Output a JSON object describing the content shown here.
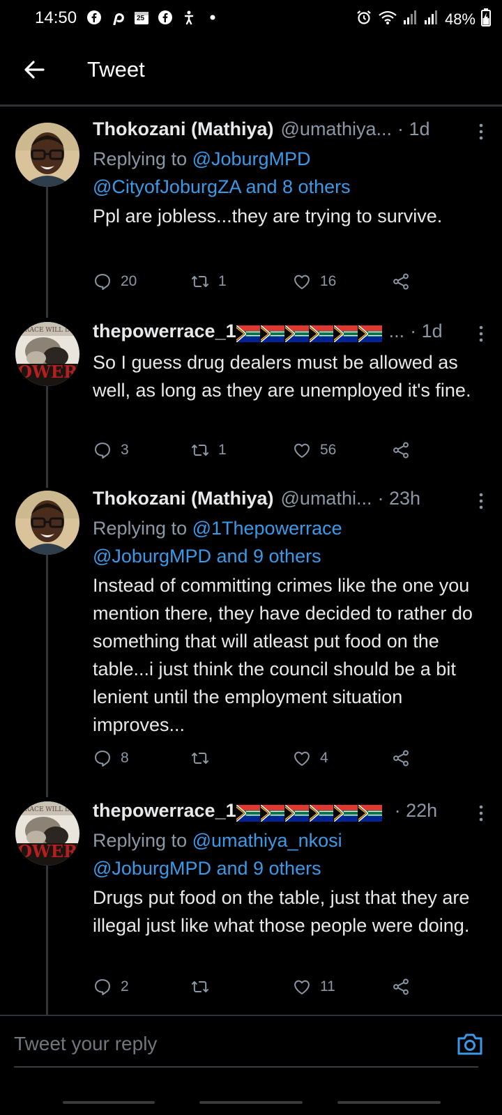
{
  "status_bar": {
    "time": "14:50",
    "battery": "48%",
    "left_icons": [
      "facebook-icon",
      "pinterest-icon",
      "calendar-icon",
      "facebook-icon",
      "accessibility-icon",
      "dot-icon"
    ],
    "calendar_day": "25",
    "right_icons": [
      "alarm-icon",
      "wifi-icon",
      "signal-icon",
      "signal-icon",
      "battery-icon"
    ]
  },
  "header": {
    "title": "Tweet"
  },
  "colors": {
    "background": "#000000",
    "link": "#3b9ae8",
    "muted": "#8b98a5",
    "text": "#e7e9ea",
    "flag_green": "#007a4d",
    "flag_blue": "#002395",
    "flag_red": "#de3831",
    "flag_gold": "#ffb612"
  },
  "tweets": [
    {
      "name": "Thokozani (Mathiya)",
      "handle": "@umathiya...",
      "time": "· 1d",
      "replying_prefix": "Replying to ",
      "replying_line1": "@JoburgMPD",
      "replying_line2": "@CityofJoburgZA and 8 others",
      "text": "Ppl are jobless...they are trying to survive.",
      "replies": "20",
      "retweets": "1",
      "likes": "16"
    },
    {
      "name": "thepowerrace_1",
      "handle": "...",
      "time": "· 1d",
      "text": "So I guess drug dealers must be allowed as well, as long as they are unemployed it's fine.",
      "replies": "3",
      "retweets": "1",
      "likes": "56"
    },
    {
      "name": "Thokozani (Mathiya)",
      "handle": "@umathi...",
      "time": "· 23h",
      "replying_prefix": "Replying to ",
      "replying_line1": "@1Thepowerrace",
      "replying_line2": "@JoburgMPD and 9 others",
      "text": "Instead of committing crimes like the one you mention there, they have decided to rather do something that will atleast put food on the table...i just think the council should be a bit lenient until the employment situation improves...",
      "replies": "8",
      "retweets": "",
      "likes": "4"
    },
    {
      "name": "thepowerrace_1",
      "handle": "",
      "time": "· 22h",
      "replying_prefix": "Replying to ",
      "replying_line1": "@umathiya_nkosi",
      "replying_line2": "@JoburgMPD and 9 others",
      "text": "Drugs put food on the table, just that they are illegal just like what those people were doing.",
      "replies": "2",
      "retweets": "",
      "likes": "11"
    }
  ],
  "reply_bar": {
    "placeholder": "Tweet your reply"
  }
}
